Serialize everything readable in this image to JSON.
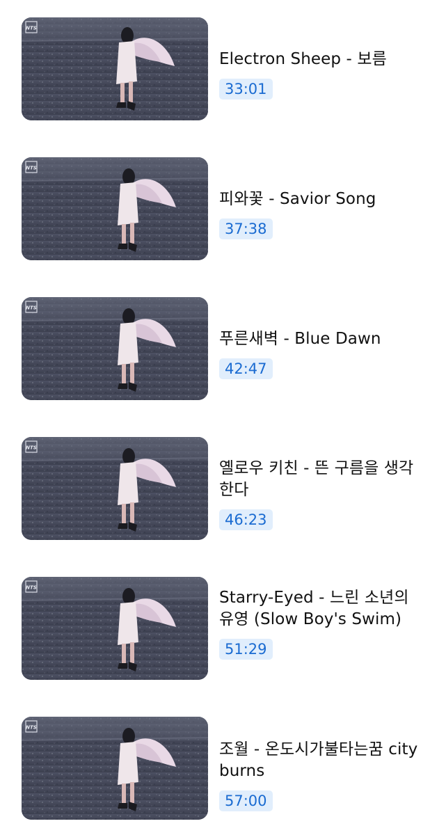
{
  "videos": [
    {
      "title": "Electron Sheep - 보름",
      "duration": "33:01",
      "thumbnail": "angel-walking-field-thumbnail",
      "badge": "NTS"
    },
    {
      "title": "피와꽃 - Savior Song",
      "duration": "37:38",
      "thumbnail": "angel-walking-field-thumbnail",
      "badge": "NTS"
    },
    {
      "title": "푸른새벽 - Blue Dawn",
      "duration": "42:47",
      "thumbnail": "angel-walking-field-thumbnail",
      "badge": "NTS"
    },
    {
      "title": "옐로우 키친 - 뜬 구름을 생각한다",
      "duration": "46:23",
      "thumbnail": "angel-walking-field-thumbnail",
      "badge": "NTS"
    },
    {
      "title": "Starry-Eyed - 느린 소년의 유영 (Slow Boy's Swim)",
      "duration": "51:29",
      "thumbnail": "angel-walking-field-thumbnail",
      "badge": "NTS"
    },
    {
      "title": "조월 - 온도시가불타는꿈 city burns",
      "duration": "57:00",
      "thumbnail": "angel-walking-field-thumbnail",
      "badge": "NTS"
    }
  ],
  "colors": {
    "duration_text": "#1a6bd1",
    "duration_bg": "#e1eefc",
    "title_text": "#111111"
  }
}
